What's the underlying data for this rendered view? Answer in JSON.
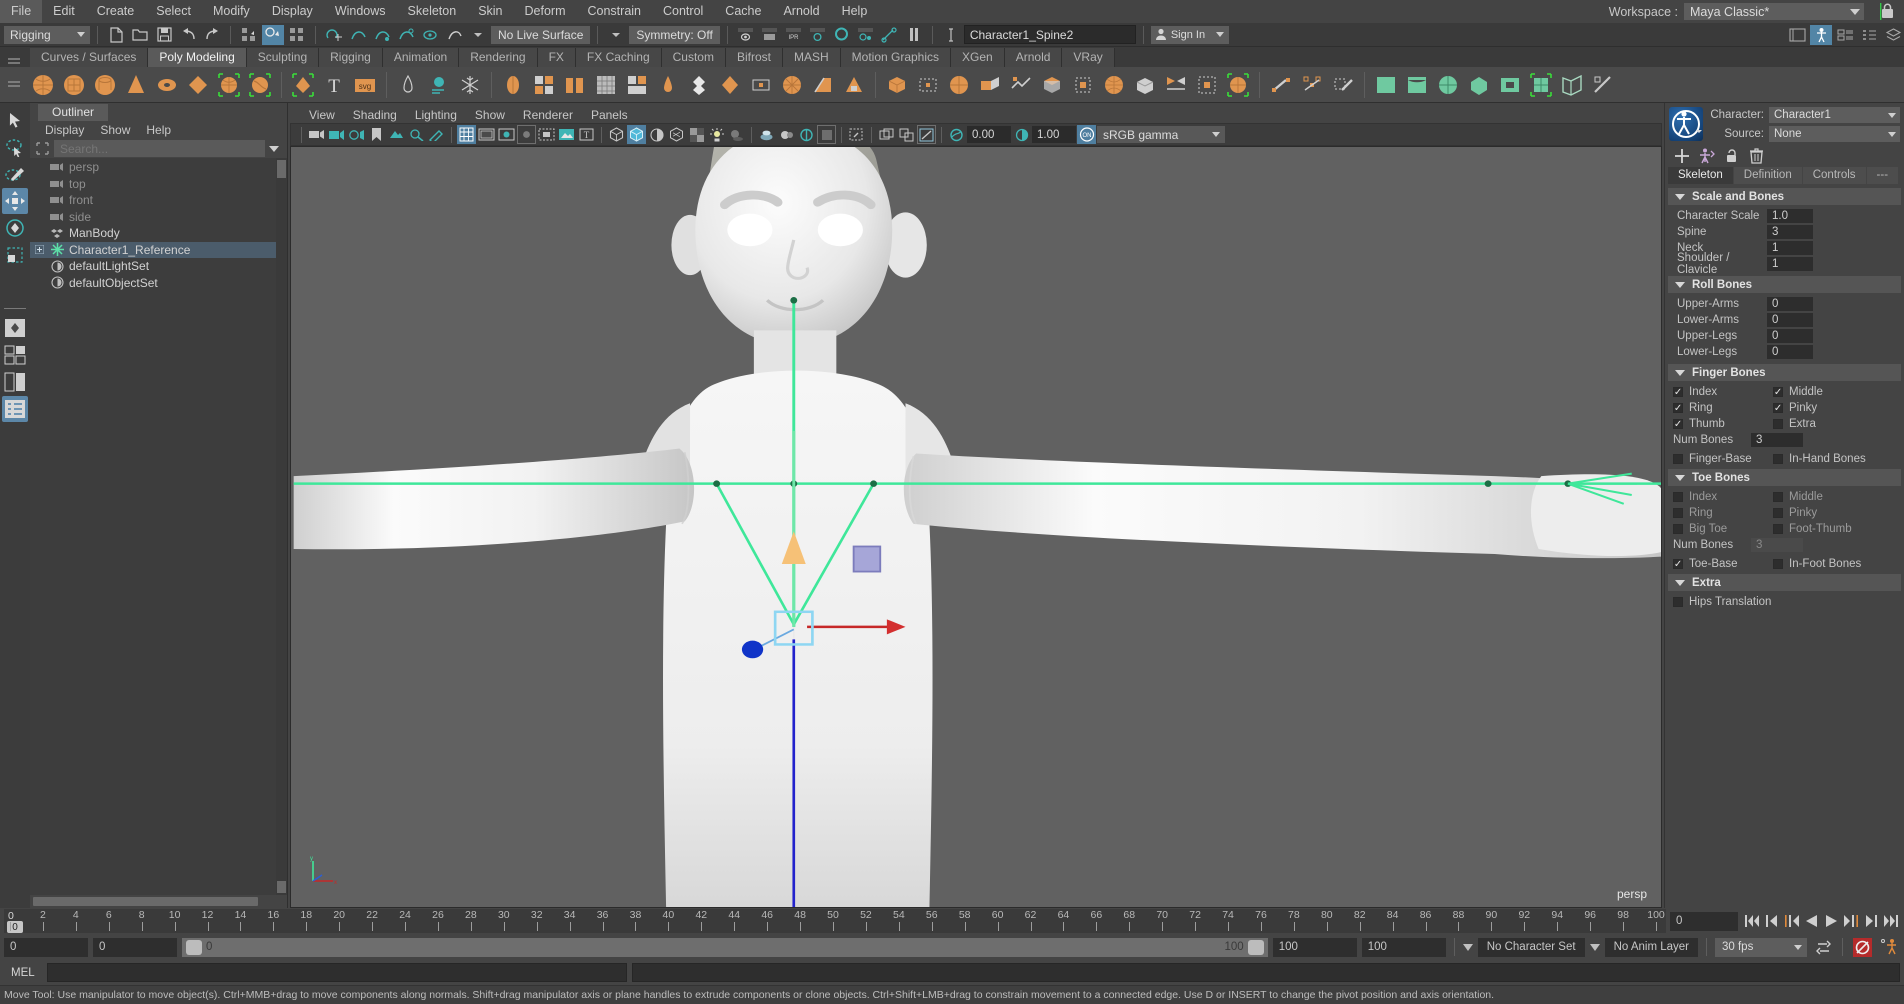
{
  "menubar": {
    "items": [
      "File",
      "Edit",
      "Create",
      "Select",
      "Modify",
      "Display",
      "Windows",
      "Skeleton",
      "Skin",
      "Deform",
      "Constrain",
      "Control",
      "Cache",
      "Arnold",
      "Help"
    ],
    "workspace_label": "Workspace :",
    "workspace_value": "Maya Classic*"
  },
  "statusline": {
    "menuset": "Rigging",
    "live_surface": "No Live Surface",
    "symmetry": "Symmetry: Off",
    "selection_field": "Character1_Spine2",
    "signin": "Sign In"
  },
  "shelf": {
    "tabs": [
      {
        "label": "Curves / Surfaces",
        "active": false
      },
      {
        "label": "Poly Modeling",
        "active": true
      },
      {
        "label": "Sculpting",
        "active": false
      },
      {
        "label": "Rigging",
        "active": false
      },
      {
        "label": "Animation",
        "active": false
      },
      {
        "label": "Rendering",
        "active": false
      },
      {
        "label": "FX",
        "active": false
      },
      {
        "label": "FX Caching",
        "active": false
      },
      {
        "label": "Custom",
        "active": false
      },
      {
        "label": "Bifrost",
        "active": false
      },
      {
        "label": "MASH",
        "active": false
      },
      {
        "label": "Motion Graphics",
        "active": false
      },
      {
        "label": "XGen",
        "active": false
      },
      {
        "label": "Arnold",
        "active": false
      },
      {
        "label": "VRay",
        "active": false
      }
    ]
  },
  "outliner": {
    "title": "Outliner",
    "menus": [
      "Display",
      "Show",
      "Help"
    ],
    "search_placeholder": "Search...",
    "items": [
      {
        "label": "persp",
        "icon": "camera-icon",
        "dim": true,
        "expand": false,
        "selected": false
      },
      {
        "label": "top",
        "icon": "camera-icon",
        "dim": true,
        "expand": false,
        "selected": false
      },
      {
        "label": "front",
        "icon": "camera-icon",
        "dim": true,
        "expand": false,
        "selected": false
      },
      {
        "label": "side",
        "icon": "camera-icon",
        "dim": true,
        "expand": false,
        "selected": false
      },
      {
        "label": "ManBody",
        "icon": "mesh-icon",
        "dim": false,
        "expand": false,
        "selected": false
      },
      {
        "label": "Character1_Reference",
        "icon": "joint-icon",
        "dim": false,
        "expand": true,
        "selected": true
      },
      {
        "label": "defaultLightSet",
        "icon": "set-icon",
        "dim": false,
        "expand": false,
        "selected": false
      },
      {
        "label": "defaultObjectSet",
        "icon": "set-icon",
        "dim": false,
        "expand": false,
        "selected": false
      }
    ]
  },
  "viewport": {
    "menus": [
      "View",
      "Shading",
      "Lighting",
      "Show",
      "Renderer",
      "Panels"
    ],
    "exposure_value": "0.00",
    "gamma_value": "1.00",
    "color_space": "sRGB gamma",
    "camera_label": "persp"
  },
  "humanik": {
    "character_label": "Character:",
    "character_value": "Character1",
    "source_label": "Source:",
    "source_value": "None",
    "tabs": [
      {
        "label": "Skeleton",
        "active": true
      },
      {
        "label": "Definition",
        "active": false
      },
      {
        "label": "Controls",
        "active": false
      },
      {
        "label": "---",
        "active": false
      }
    ],
    "sections": [
      {
        "title": "Scale and Bones",
        "rows": [
          {
            "label": "Character Scale",
            "value": "1.0",
            "disabled": false
          },
          {
            "label": "Spine",
            "value": "3",
            "disabled": false
          },
          {
            "label": "Neck",
            "value": "1",
            "disabled": false
          },
          {
            "label": "Shoulder / Clavicle",
            "value": "1",
            "disabled": false
          }
        ]
      },
      {
        "title": "Roll Bones",
        "rows": [
          {
            "label": "Upper-Arms",
            "value": "0",
            "disabled": false
          },
          {
            "label": "Lower-Arms",
            "value": "0",
            "disabled": false
          },
          {
            "label": "Upper-Legs",
            "value": "0",
            "disabled": false
          },
          {
            "label": "Lower-Legs",
            "value": "0",
            "disabled": false
          }
        ]
      }
    ],
    "finger_bones": {
      "title": "Finger Bones",
      "col_left": [
        {
          "label": "Index",
          "checked": true
        },
        {
          "label": "Ring",
          "checked": true
        },
        {
          "label": "Thumb",
          "checked": true
        }
      ],
      "col_right": [
        {
          "label": "Middle",
          "checked": true
        },
        {
          "label": "Pinky",
          "checked": true
        },
        {
          "label": "Extra",
          "checked": false
        }
      ],
      "num_bones_label": "Num Bones",
      "num_bones_value": "3",
      "num_bones_disabled": false,
      "extra_left": {
        "label": "Finger-Base",
        "checked": false
      },
      "extra_right": {
        "label": "In-Hand Bones",
        "checked": false
      }
    },
    "toe_bones": {
      "title": "Toe Bones",
      "col_left": [
        {
          "label": "Index",
          "checked": false
        },
        {
          "label": "Ring",
          "checked": false
        },
        {
          "label": "Big Toe",
          "checked": false
        }
      ],
      "col_right": [
        {
          "label": "Middle",
          "checked": false
        },
        {
          "label": "Pinky",
          "checked": false
        },
        {
          "label": "Foot-Thumb",
          "checked": false
        }
      ],
      "num_bones_label": "Num Bones",
      "num_bones_value": "3",
      "num_bones_disabled": true,
      "extra_left": {
        "label": "Toe-Base",
        "checked": true
      },
      "extra_right": {
        "label": "In-Foot Bones",
        "checked": false
      }
    },
    "extra": {
      "title": "Extra",
      "hips_translation": {
        "label": "Hips Translation",
        "checked": false
      }
    }
  },
  "timeline": {
    "start": 0,
    "end": 100,
    "tick_step": 2,
    "current_frame": "0",
    "current_frame_field": "0"
  },
  "rangebar": {
    "anim_start": "0",
    "range_start": "0",
    "slider_left_num": "0",
    "slider_right_num": "100",
    "range_end": "100",
    "anim_end": "100",
    "character_set": "No Character Set",
    "anim_layer": "No Anim Layer",
    "fps": "30 fps"
  },
  "commandline": {
    "language": "MEL",
    "input_value": ""
  },
  "helpline": {
    "text": "Move Tool: Use manipulator to move object(s). Ctrl+MMB+drag to move components along normals. Shift+drag manipulator axis or plane handles to extrude components or clone objects. Ctrl+Shift+LMB+drag to constrain movement to a connected edge. Use D or INSERT to change the pivot position and axis orientation."
  },
  "colors": {
    "accent_blue": "#5285a6",
    "skeleton_green": "#4ce49a",
    "x_axis_red": "#c62828",
    "y_axis_orange": "#f2b35a",
    "z_axis_blue": "#2222cc",
    "shelf_orange": "#e0954f",
    "teal": "#3fb5b5"
  }
}
